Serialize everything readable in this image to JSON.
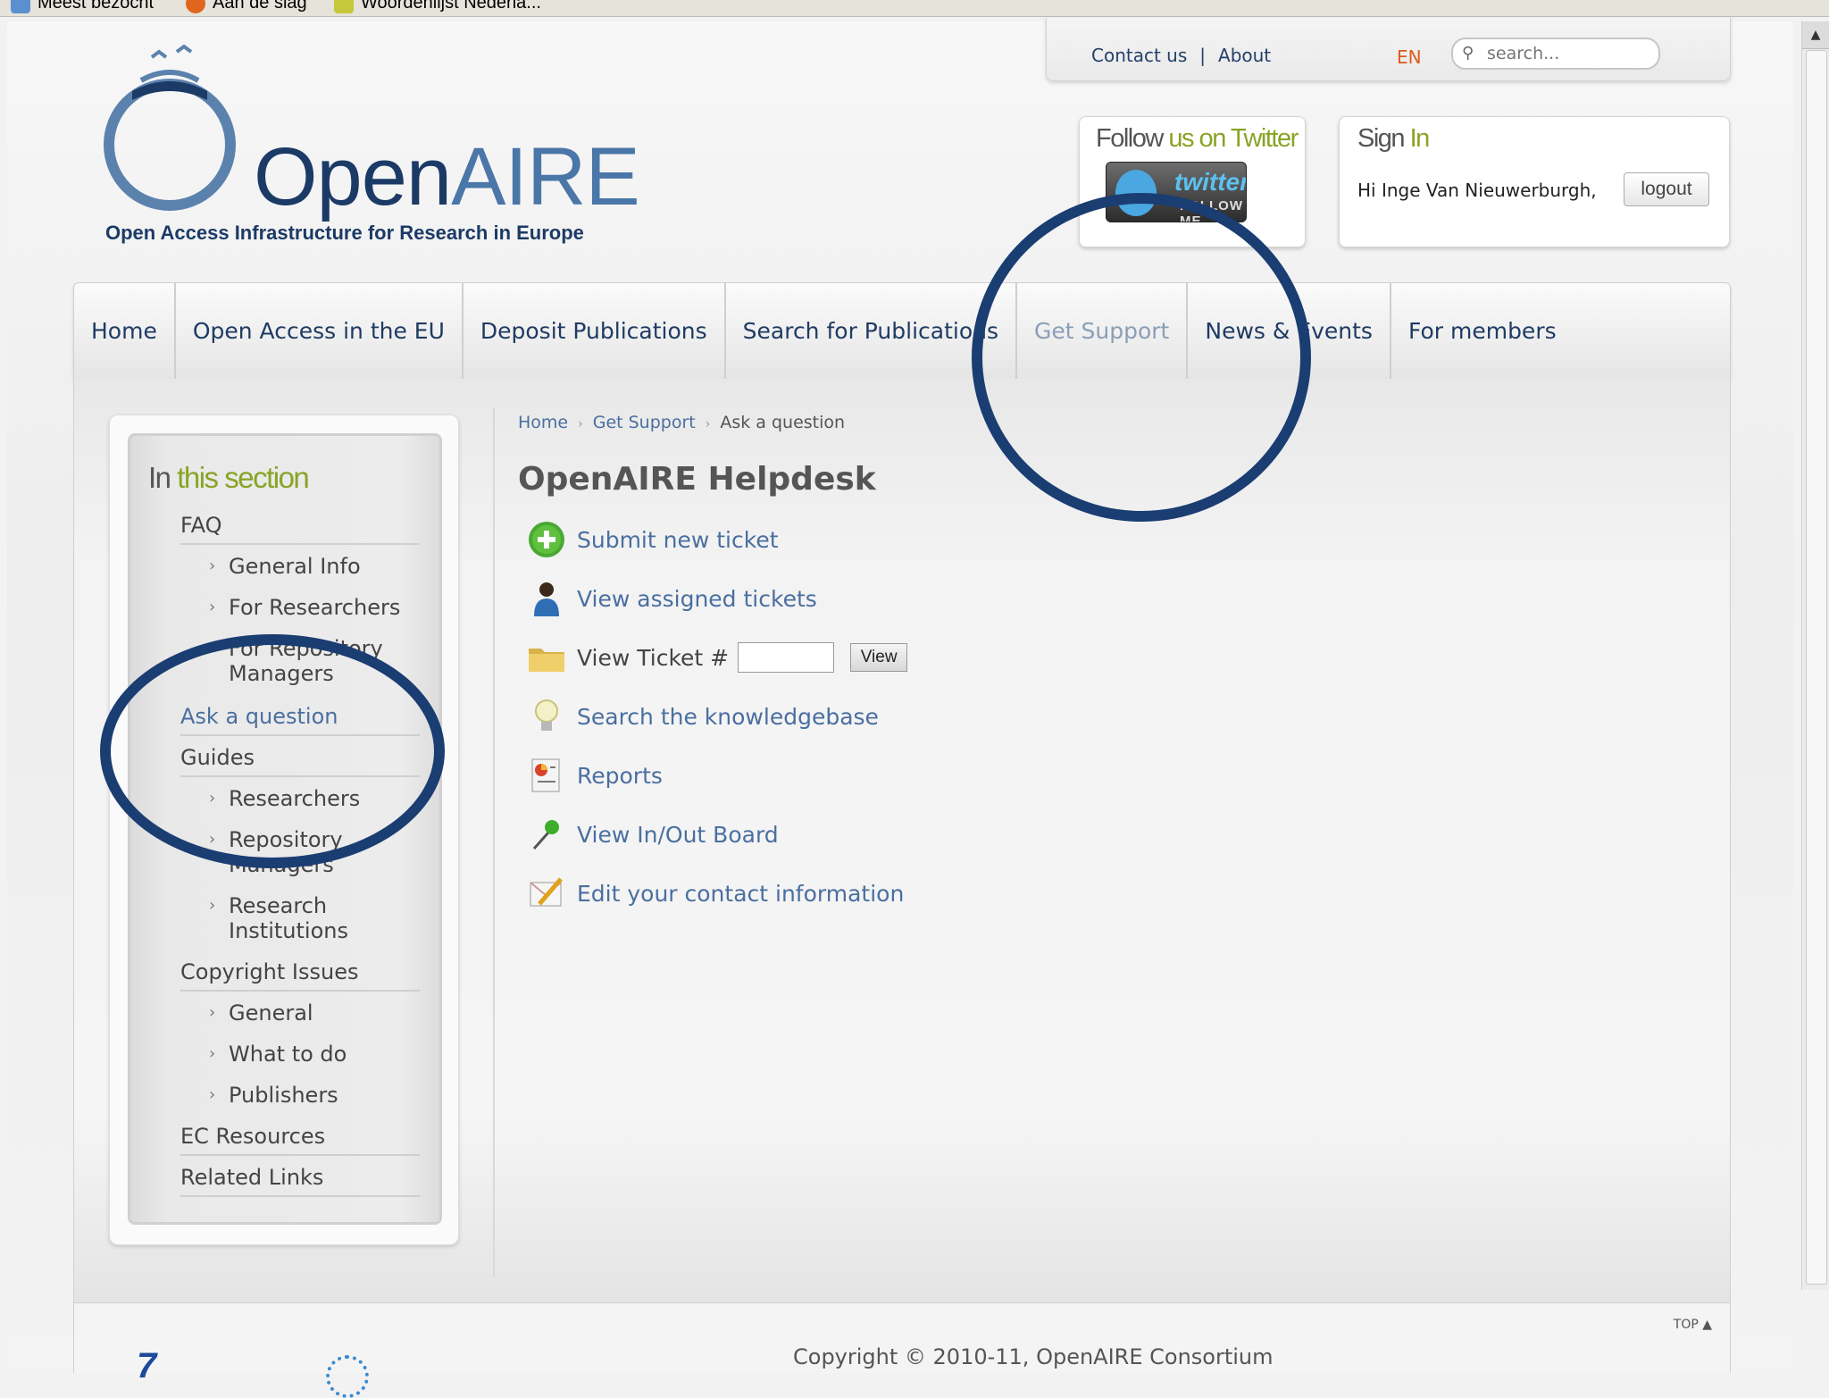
{
  "bookmarks": [
    "Meest bezocht",
    "Aan de slag",
    "Woordenlijst Nederla..."
  ],
  "topbar": {
    "contact_label": "Contact us",
    "separator": "|",
    "about_label": "About",
    "language": "EN",
    "search_placeholder": "search..."
  },
  "logo": {
    "name_part1": "Open",
    "name_part2": "AIRE",
    "tagline": "Open Access Infrastructure for Research in Europe"
  },
  "twitter": {
    "title_part1": "Follow",
    "title_part2": "us on Twitter",
    "button_text": "twitter",
    "button_sub": "FOLLOW ME"
  },
  "signin": {
    "title_part1": "Sign",
    "title_part2": "In",
    "greeting": "Hi Inge Van Nieuwerburgh,",
    "logout_label": "logout"
  },
  "nav": {
    "items": [
      {
        "label": "Home"
      },
      {
        "label": "Open Access in the EU"
      },
      {
        "label": "Deposit Publications"
      },
      {
        "label": "Search for Publications"
      },
      {
        "label": "Get Support"
      },
      {
        "label": "News & Events"
      },
      {
        "label": "For members"
      }
    ],
    "active": "Get Support"
  },
  "sidebar": {
    "title_part1": "In",
    "title_part2": "this section",
    "items": [
      {
        "label": "FAQ"
      },
      {
        "label": "General Info"
      },
      {
        "label": "For Researchers"
      },
      {
        "label": "For Repository Managers"
      },
      {
        "label": "Ask a question"
      },
      {
        "label": "Guides"
      },
      {
        "label": "Researchers"
      },
      {
        "label": "Repository Managers"
      },
      {
        "label": "Research Institutions"
      },
      {
        "label": "Copyright Issues"
      },
      {
        "label": "General"
      },
      {
        "label": "What to do"
      },
      {
        "label": "Publishers"
      },
      {
        "label": "EC Resources"
      },
      {
        "label": "Related Links"
      }
    ]
  },
  "breadcrumb": {
    "items": [
      "Home",
      "Get Support",
      "Ask a question"
    ],
    "separator": "›"
  },
  "helpdesk": {
    "title": "OpenAIRE Helpdesk",
    "actions": [
      {
        "label": "Submit new ticket",
        "icon": "plus-circle-icon"
      },
      {
        "label": "View assigned tickets",
        "icon": "person-icon"
      },
      {
        "label": "View Ticket #",
        "icon": "folder-icon"
      },
      {
        "label": "Search the knowledgebase",
        "icon": "lightbulb-icon"
      },
      {
        "label": "Reports",
        "icon": "report-icon"
      },
      {
        "label": "View In/Out Board",
        "icon": "pushpin-icon"
      },
      {
        "label": "Edit your contact information",
        "icon": "edit-contact-icon"
      }
    ],
    "ticket_input_value": "",
    "view_button_label": "View"
  },
  "footer": {
    "copyright": "Copyright © 2010-11, OpenAIRE Consortium",
    "top_label": "TOP ▲",
    "logo_mark": "7"
  },
  "colors": {
    "brand_dark_blue": "#1c3a66",
    "brand_light_blue": "#4a76a8",
    "accent_green": "#8aa325",
    "link_blue": "#4a6fa0",
    "annotation_circle": "#1a3d72",
    "language_orange": "#e05a1a"
  }
}
